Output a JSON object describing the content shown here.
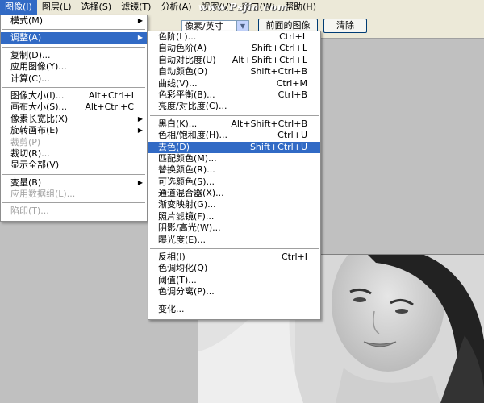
{
  "menubar": {
    "items": [
      {
        "label": "图像(I)",
        "active": true
      },
      {
        "label": "图层(L)"
      },
      {
        "label": "选择(S)"
      },
      {
        "label": "滤镜(T)"
      },
      {
        "label": "分析(A)"
      },
      {
        "label": "视图(V)"
      },
      {
        "label": "窗口(W)"
      },
      {
        "label": "帮助(H)"
      }
    ],
    "watermark": "www.Psjia.com"
  },
  "options": {
    "unit_select": "像素/英寸",
    "front_image_button": "前面的图像",
    "clear_button": "清除"
  },
  "image_menu": [
    {
      "label": "模式(M)",
      "sub": "▶"
    },
    {
      "sep": true
    },
    {
      "label": "调整(A)",
      "sub": "▶",
      "hl": true
    },
    {
      "sep": true
    },
    {
      "label": "复制(D)..."
    },
    {
      "label": "应用图像(Y)..."
    },
    {
      "label": "计算(C)..."
    },
    {
      "sep": true
    },
    {
      "label": "图像大小(I)...",
      "sc": "Alt+Ctrl+I"
    },
    {
      "label": "画布大小(S)...",
      "sc": "Alt+Ctrl+C"
    },
    {
      "label": "像素长宽比(X)",
      "sub": "▶"
    },
    {
      "label": "旋转画布(E)",
      "sub": "▶"
    },
    {
      "label": "裁剪(P)",
      "dis": true
    },
    {
      "label": "裁切(R)..."
    },
    {
      "label": "显示全部(V)"
    },
    {
      "sep": true
    },
    {
      "label": "变量(B)",
      "sub": "▶"
    },
    {
      "label": "应用数据组(L)...",
      "dis": true
    },
    {
      "sep": true
    },
    {
      "label": "陷印(T)...",
      "dis": true
    }
  ],
  "adjust_menu": [
    {
      "label": "色阶(L)...",
      "sc": "Ctrl+L"
    },
    {
      "label": "自动色阶(A)",
      "sc": "Shift+Ctrl+L"
    },
    {
      "label": "自动对比度(U)",
      "sc": "Alt+Shift+Ctrl+L"
    },
    {
      "label": "自动颜色(O)",
      "sc": "Shift+Ctrl+B"
    },
    {
      "label": "曲线(V)...",
      "sc": "Ctrl+M"
    },
    {
      "label": "色彩平衡(B)...",
      "sc": "Ctrl+B"
    },
    {
      "label": "亮度/对比度(C)..."
    },
    {
      "sep": true
    },
    {
      "label": "黑白(K)...",
      "sc": "Alt+Shift+Ctrl+B"
    },
    {
      "label": "色相/饱和度(H)...",
      "sc": "Ctrl+U"
    },
    {
      "label": "去色(D)",
      "sc": "Shift+Ctrl+U",
      "hl": true
    },
    {
      "label": "匹配颜色(M)..."
    },
    {
      "label": "替换颜色(R)..."
    },
    {
      "label": "可选颜色(S)..."
    },
    {
      "label": "通道混合器(X)..."
    },
    {
      "label": "渐变映射(G)..."
    },
    {
      "label": "照片滤镜(F)..."
    },
    {
      "label": "阴影/高光(W)..."
    },
    {
      "label": "曝光度(E)..."
    },
    {
      "sep": true
    },
    {
      "label": "反相(I)",
      "sc": "Ctrl+I"
    },
    {
      "label": "色调均化(Q)"
    },
    {
      "label": "阈值(T)..."
    },
    {
      "label": "色调分离(P)..."
    },
    {
      "sep": true
    },
    {
      "label": "变化..."
    }
  ]
}
